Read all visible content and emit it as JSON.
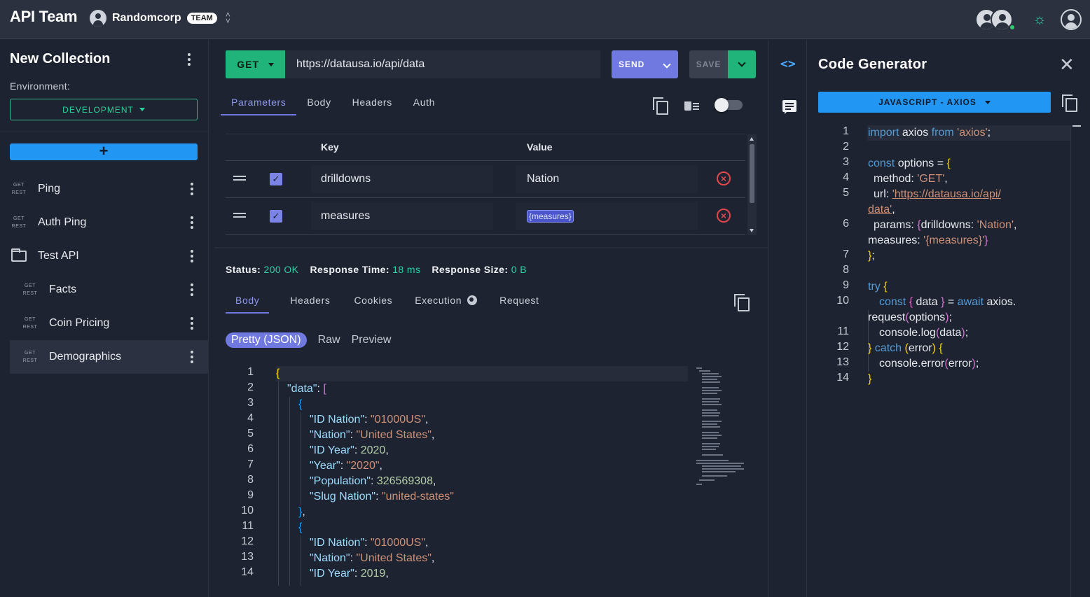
{
  "header": {
    "brand": "API Team",
    "org_name": "Randomcorp",
    "org_badge": "TEAM"
  },
  "sidebar": {
    "collection_title": "New Collection",
    "environment_label": "Environment:",
    "environment_value": "DEVELOPMENT",
    "add_label": "+",
    "items": [
      {
        "method": "GET",
        "type": "REST",
        "label": "Ping"
      },
      {
        "method": "GET",
        "type": "REST",
        "label": "Auth Ping"
      },
      {
        "label": "Test API",
        "kind": "folder"
      },
      {
        "method": "GET",
        "type": "REST",
        "label": "Facts"
      },
      {
        "method": "GET",
        "type": "REST",
        "label": "Coin Pricing"
      },
      {
        "method": "GET",
        "type": "REST",
        "label": "Demographics",
        "active": true
      }
    ]
  },
  "request": {
    "method": "GET",
    "url": "https://datausa.io/api/data",
    "send_label": "SEND",
    "save_label": "SAVE",
    "tabs": [
      "Parameters",
      "Body",
      "Headers",
      "Auth"
    ],
    "params_header": {
      "key": "Key",
      "value": "Value"
    },
    "params": [
      {
        "key": "drilldowns",
        "value": "Nation",
        "enabled": true
      },
      {
        "key": "measures",
        "value": "{measures}",
        "enabled": true,
        "is_variable": true
      }
    ]
  },
  "response": {
    "status_label": "Status:",
    "status_value": "200 OK",
    "time_label": "Response Time:",
    "time_value": "18 ms",
    "size_label": "Response Size:",
    "size_value": "0 B",
    "tabs": [
      "Body",
      "Headers",
      "Cookies",
      "Execution",
      "Request"
    ],
    "formats": [
      "Pretty (JSON)",
      "Raw",
      "Preview"
    ],
    "body": {
      "l2_key": "\"data\"",
      "r1": {
        "k1": "\"ID Nation\"",
        "v1": "\"01000US\"",
        "k2": "\"Nation\"",
        "v2": "\"United States\"",
        "k3": "\"ID Year\"",
        "v3": "2020",
        "k4": "\"Year\"",
        "v4": "\"2020\"",
        "k5": "\"Population\"",
        "v5": "326569308",
        "k6": "\"Slug Nation\"",
        "v6": "\"united-states\""
      },
      "r2": {
        "k1": "\"ID Nation\"",
        "v1": "\"01000US\"",
        "k2": "\"Nation\"",
        "v2": "\"United States\"",
        "k3": "\"ID Year\"",
        "v3": "2019"
      }
    }
  },
  "codegen": {
    "title": "Code Generator",
    "language": "JAVASCRIPT - AXIOS",
    "code": {
      "import_kw": "import",
      "import_name": "axios",
      "from_kw": "from",
      "import_src": "'axios'",
      "const_kw": "const",
      "options_name": "options",
      "method_key": "method:",
      "method_val": "'GET'",
      "url_key": "url:",
      "url_val_1": "'https://datausa.io/api/",
      "url_val_2": "data'",
      "params_key": "params:",
      "drill_key": "drilldowns:",
      "drill_val": "'Nation'",
      "measures_key": "measures:",
      "measures_val": "'{measures}'",
      "try_kw": "try",
      "data_name": "data",
      "await_kw": "await",
      "axios_call_1": "axios.",
      "axios_call_2": "request",
      "options_arg": "options",
      "log_call": "console.log",
      "catch_kw": "catch",
      "error_name": "error",
      "error_call": "console.error"
    }
  }
}
